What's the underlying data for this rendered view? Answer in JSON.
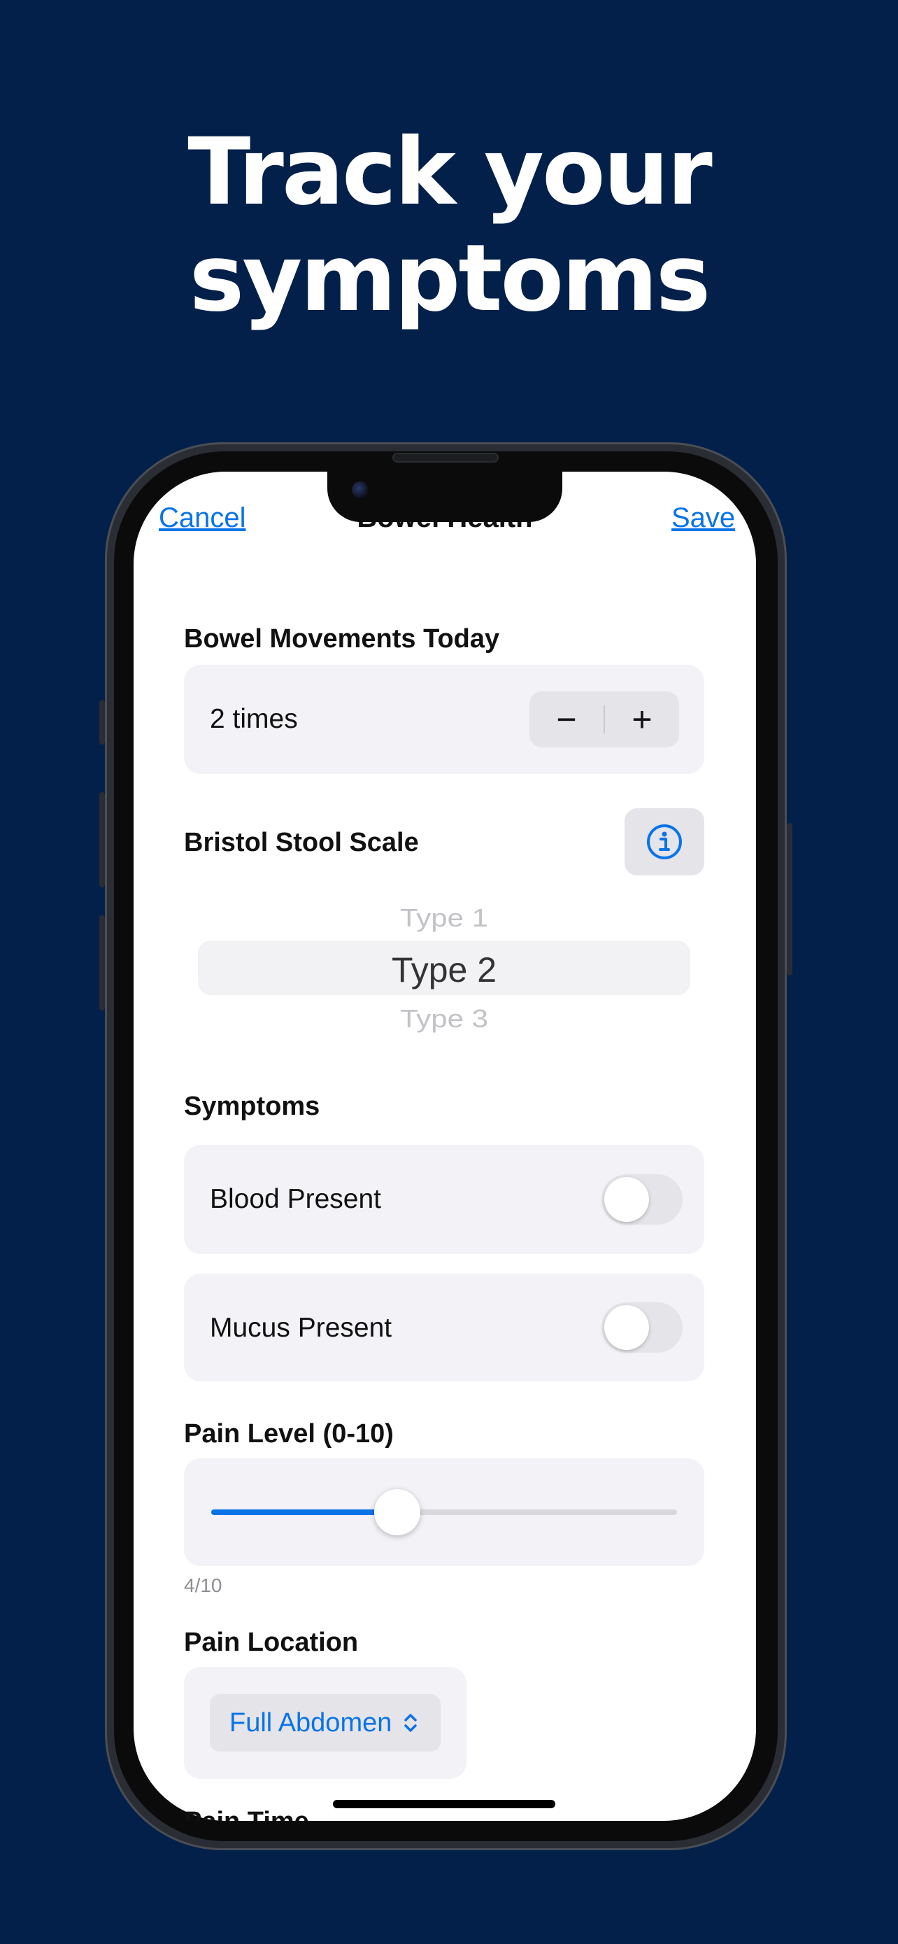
{
  "headline": {
    "line1": "Track your",
    "line2": "symptoms"
  },
  "nav": {
    "cancel": "Cancel",
    "title": "Bowel Health",
    "save": "Save"
  },
  "bowel_movements": {
    "label": "Bowel Movements Today",
    "value": "2 times",
    "decrement": "−",
    "increment": "+"
  },
  "bristol": {
    "label": "Bristol Stool Scale",
    "info_icon": "info-circle-icon",
    "options": [
      "Type 1",
      "Type 2",
      "Type 3"
    ],
    "selected": "Type 2"
  },
  "symptoms": {
    "label": "Symptoms",
    "items": [
      {
        "label": "Blood Present",
        "on": false
      },
      {
        "label": "Mucus Present",
        "on": false
      }
    ]
  },
  "pain_level": {
    "label": "Pain Level (0-10)",
    "value": 4,
    "max": 10,
    "caption": "4/10"
  },
  "pain_location": {
    "label": "Pain Location",
    "selected": "Full Abdomen",
    "chevron_icon": "chevron-up-down-icon"
  },
  "next_section": {
    "label": "Pain Time"
  },
  "colors": {
    "background": "#03204a",
    "accent": "#0a73e8",
    "card": "#f2f2f7"
  }
}
